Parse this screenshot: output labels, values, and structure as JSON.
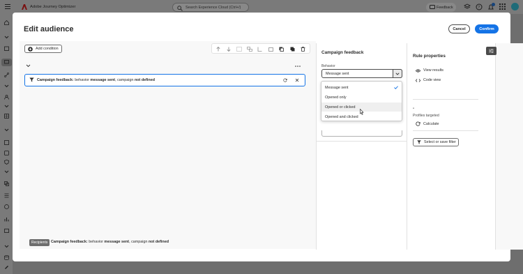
{
  "app": {
    "title": "Adobe Journey Optimizer",
    "search_placeholder": "Search Experience Cloud (Ctrl+/)",
    "feedback_label": "Feedback"
  },
  "modal": {
    "title": "Edit audience",
    "cancel_label": "Cancel",
    "confirm_label": "Confirm"
  },
  "canvas": {
    "add_condition_label": "Add condition",
    "condition": {
      "category": "Campaign feedback:",
      "t1": " behavior ",
      "v1": "message sent",
      "t2": ", campaign ",
      "v2": "not defined"
    }
  },
  "footer": {
    "recipients_tag": "Recipients",
    "category": "Campaign feedback:",
    "t1": " behavior ",
    "v1": "message sent",
    "t2": ", campaign ",
    "v2": "not defined"
  },
  "campaign_panel": {
    "title": "Campaign feedback",
    "behavior_label": "Behavior",
    "behavior_value": "Message sent",
    "options": [
      "Message sent",
      "Opened only",
      "Opened or clicked",
      "Opened and clicked"
    ],
    "selected_index": 0,
    "hovered_index": 2
  },
  "rule_panel": {
    "title": "Rule properties",
    "view_results": "View results",
    "code_view": "Code view",
    "count": "-",
    "profiles_targeted": "Profiles targeted",
    "calculate": "Calculate",
    "select_save_filter": "Select or save filter"
  },
  "colors": {
    "accent": "#1473e6",
    "overlay": "#6e6e6e"
  }
}
